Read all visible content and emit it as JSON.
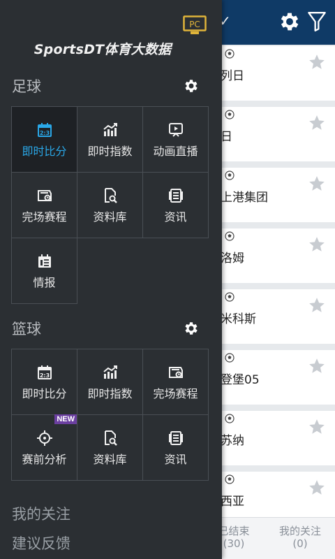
{
  "background": {
    "matches": [
      {
        "team": "列日"
      },
      {
        "team": "日"
      },
      {
        "team": "上港集团"
      },
      {
        "team": "洛姆"
      },
      {
        "team": "米科斯"
      },
      {
        "team": "登堡05"
      },
      {
        "team": "苏纳"
      },
      {
        "team": "西亚"
      }
    ],
    "bottom_tabs": [
      {
        "label": "已结束",
        "count": "(30)"
      },
      {
        "label": "我的关注",
        "count": "(0)"
      }
    ]
  },
  "drawer": {
    "pc_badge": "PC",
    "app_title": "SportsDT体育大数据",
    "football": {
      "title": "足球",
      "items": [
        {
          "label": "即时比分",
          "icon": "live-score-icon",
          "active": true
        },
        {
          "label": "即时指数",
          "icon": "trend-chart-icon"
        },
        {
          "label": "动画直播",
          "icon": "animation-live-icon"
        },
        {
          "label": "完场赛程",
          "icon": "schedule-icon"
        },
        {
          "label": "资料库",
          "icon": "database-search-icon"
        },
        {
          "label": "资讯",
          "icon": "news-icon"
        },
        {
          "label": "情报",
          "icon": "intel-icon"
        }
      ]
    },
    "basketball": {
      "title": "篮球",
      "items": [
        {
          "label": "即时比分",
          "icon": "live-score-icon"
        },
        {
          "label": "即时指数",
          "icon": "trend-chart-icon"
        },
        {
          "label": "完场赛程",
          "icon": "schedule-icon"
        },
        {
          "label": "赛前分析",
          "icon": "target-icon",
          "badge": "NEW"
        },
        {
          "label": "资料库",
          "icon": "database-search-icon"
        },
        {
          "label": "资讯",
          "icon": "news-icon"
        }
      ]
    },
    "links": [
      {
        "label": "我的关注"
      },
      {
        "label": "建议反馈"
      }
    ]
  },
  "colors": {
    "drawer_bg": "#2b2f33",
    "active_accent": "#2aa8e8",
    "header_bg": "#0f3a66",
    "new_badge": "#6b3fa0"
  }
}
